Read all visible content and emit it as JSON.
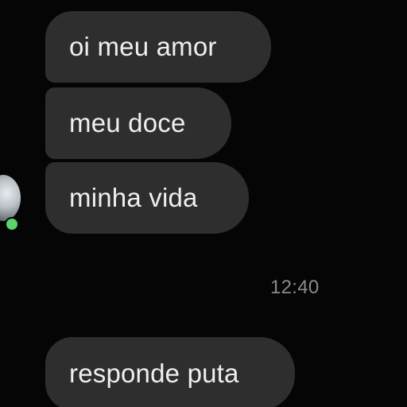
{
  "messages": [
    {
      "text": "oi meu amor"
    },
    {
      "text": "meu doce"
    },
    {
      "text": "minha vida"
    },
    {
      "text": "responde puta"
    }
  ],
  "timestamp": "12:40",
  "colors": {
    "background": "#050505",
    "bubble": "#2e2e2e",
    "bubble_text": "#efefef",
    "timestamp_text": "#8a8a8a",
    "online_indicator": "#5bd36a"
  }
}
